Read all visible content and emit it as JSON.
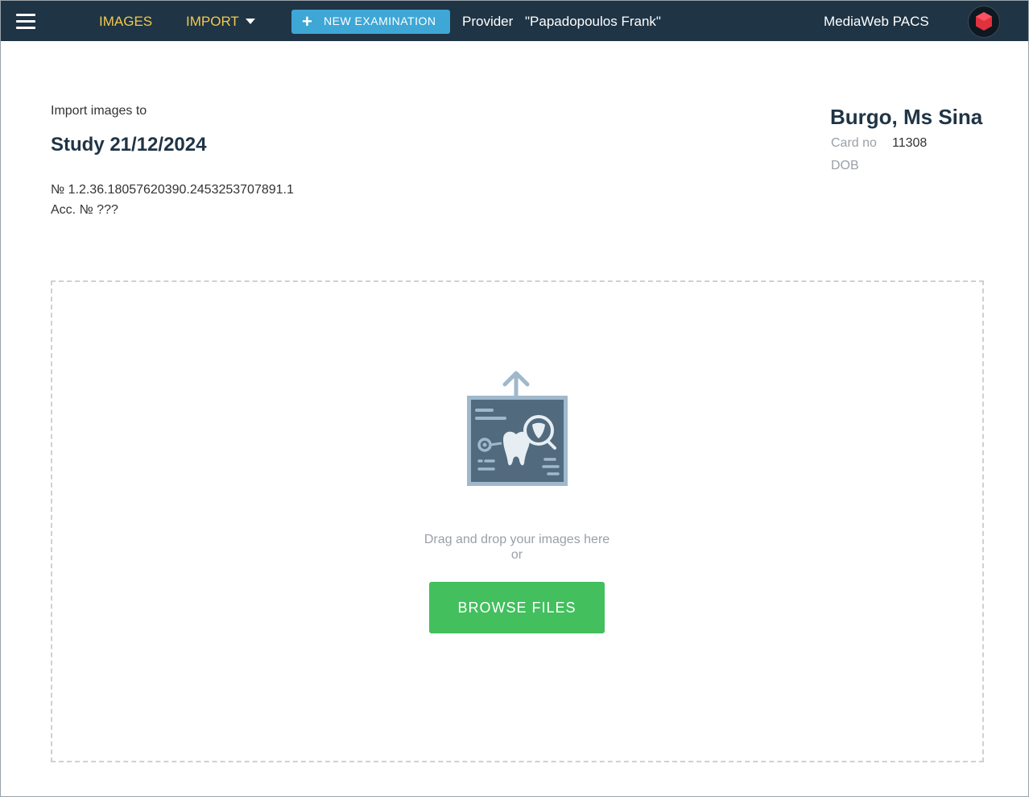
{
  "topbar": {
    "menu_icon": "hamburger-menu-icon",
    "images_label": "IMAGES",
    "import_label": "IMPORT",
    "new_exam_label": "NEW EXAMINATION",
    "provider_label": "Provider",
    "provider_name": "\"Papadopoulos Frank\"",
    "app_name": "MediaWeb PACS",
    "logo_icon": "hexagon-logo-icon",
    "accent_color": "#f2c94c",
    "bar_color": "#1f3445"
  },
  "study": {
    "import_to": "Import images to",
    "title": "Study 21/12/2024",
    "uid": "№ 1.2.36.18057620390.2453253707891.1",
    "accession": "Acc. № ???"
  },
  "patient": {
    "name": "Burgo, Ms Sina",
    "card_label": "Card no",
    "card_value": "11308",
    "dob_label": "DOB"
  },
  "dropzone": {
    "icon": "dental-xray-upload-icon",
    "drag_text": "Drag and drop your images here",
    "or_text": "or",
    "browse_label": "BROWSE FILES",
    "button_color": "#43bf5e"
  }
}
